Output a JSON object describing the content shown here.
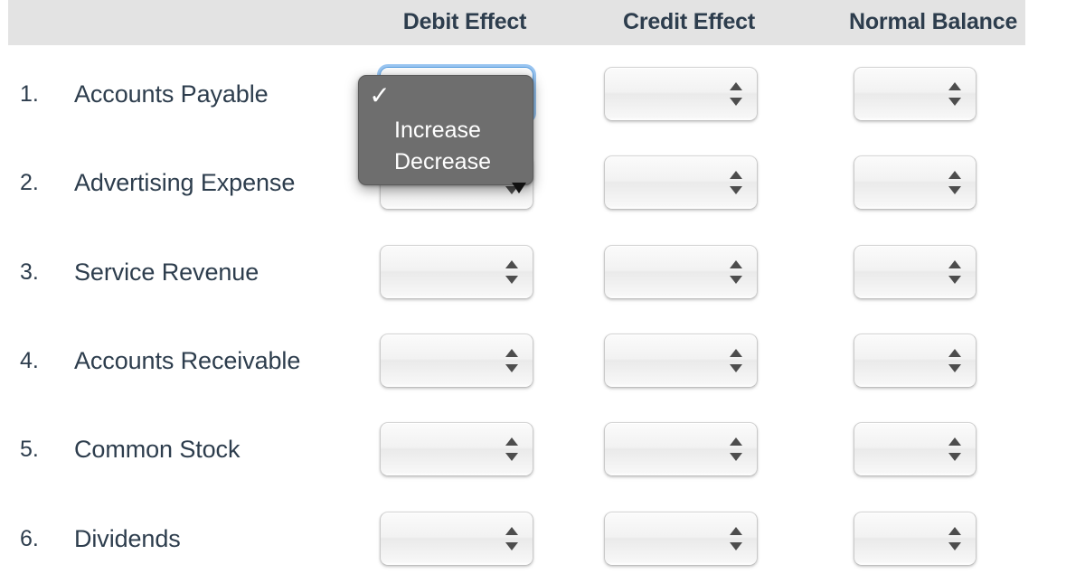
{
  "table": {
    "columns": [
      {
        "id": "debit",
        "label": "Debit Effect"
      },
      {
        "id": "credit",
        "label": "Credit Effect"
      },
      {
        "id": "normal",
        "label": "Normal Balance"
      }
    ],
    "rows": [
      {
        "number": "1.",
        "account": "Accounts Payable",
        "debit": "",
        "credit": "",
        "normal": ""
      },
      {
        "number": "2.",
        "account": "Advertising Expense",
        "debit": "",
        "credit": "",
        "normal": ""
      },
      {
        "number": "3.",
        "account": "Service Revenue",
        "debit": "",
        "credit": "",
        "normal": ""
      },
      {
        "number": "4.",
        "account": "Accounts Receivable",
        "debit": "",
        "credit": "",
        "normal": ""
      },
      {
        "number": "5.",
        "account": "Common Stock",
        "debit": "",
        "credit": "",
        "normal": ""
      },
      {
        "number": "6.",
        "account": "Dividends",
        "debit": "",
        "credit": "",
        "normal": ""
      }
    ]
  },
  "dropdown": {
    "open_for": "row-1-debit-effect",
    "selected_value": "",
    "options": [
      {
        "label": "",
        "checked": true
      },
      {
        "label": "Increase",
        "checked": false
      },
      {
        "label": "Decrease",
        "checked": false
      }
    ],
    "check_glyph": "✓",
    "scroll_indicator": "▼"
  },
  "colors": {
    "header_background": "#e3e3e3",
    "text": "#2d3d4d",
    "popup_background": "#6e6e6e",
    "popup_text": "#ffffff",
    "focus_ring": "#5a9fe0",
    "page_background": "#ffffff"
  }
}
